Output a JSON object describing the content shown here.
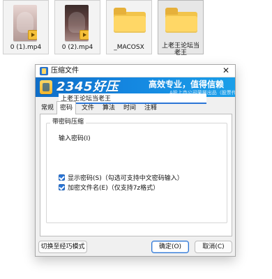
{
  "files": [
    {
      "name": "0 (1).mp4"
    },
    {
      "name": "0 (2).mp4"
    },
    {
      "name": "_MACOSX"
    },
    {
      "name": "上老王论坛当老王"
    }
  ],
  "dialog": {
    "title": "压缩文件",
    "close_glyph": "✕",
    "banner": {
      "brand": "2345好压",
      "slogan": "高效专业，值得信赖",
      "subtext": "A股上市公司荣誉出品（股票代码：002195）"
    },
    "tabs": [
      "常规",
      "密码",
      "文件",
      "算法",
      "时间",
      "注释"
    ],
    "active_tab_index": 1,
    "group_title": "带密码压缩",
    "password": {
      "label": "输入密码(I)",
      "value": "上老王论坛当老王"
    },
    "checkboxes": [
      {
        "label": "显示密码(S)（勾选可支持中文密码输入）",
        "checked": true
      },
      {
        "label": "加密文件名(E)（仅支持7z格式）",
        "checked": true
      }
    ],
    "buttons": {
      "switch_mode": "切换至经巧模式",
      "ok": "确定(O)",
      "cancel": "取消(C)"
    }
  }
}
